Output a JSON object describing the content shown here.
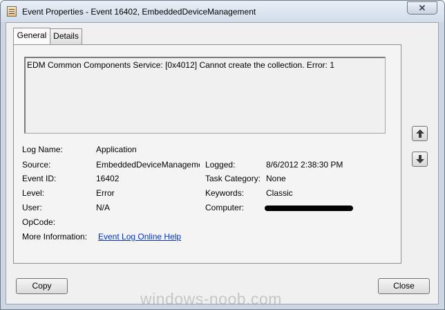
{
  "window": {
    "title": "Event Properties - Event 16402, EmbeddedDeviceManagement",
    "close_glyph": "✕"
  },
  "tabs": [
    {
      "label": "General",
      "active": true
    },
    {
      "label": "Details",
      "active": false
    }
  ],
  "general": {
    "message": "EDM Common Components Service: [0x4012] Cannot create the collection. Error: 1",
    "log_name_label": "Log Name:",
    "log_name": "Application",
    "source_label": "Source:",
    "source": "EmbeddedDeviceManageme",
    "logged_label": "Logged:",
    "logged": "8/6/2012 2:38:30 PM",
    "event_id_label": "Event ID:",
    "event_id": "16402",
    "task_category_label": "Task Category:",
    "task_category": "None",
    "level_label": "Level:",
    "level": "Error",
    "keywords_label": "Keywords:",
    "keywords": "Classic",
    "user_label": "User:",
    "user": "N/A",
    "computer_label": "Computer:",
    "opcode_label": "OpCode:",
    "more_info_label": "More Information:",
    "more_info_link": "Event Log Online Help"
  },
  "buttons": {
    "copy": "Copy",
    "close": "Close"
  },
  "icons": {
    "app": "event-viewer-icon",
    "up": "arrow-up-icon",
    "down": "arrow-down-icon"
  },
  "watermark": "windows-noob.com"
}
